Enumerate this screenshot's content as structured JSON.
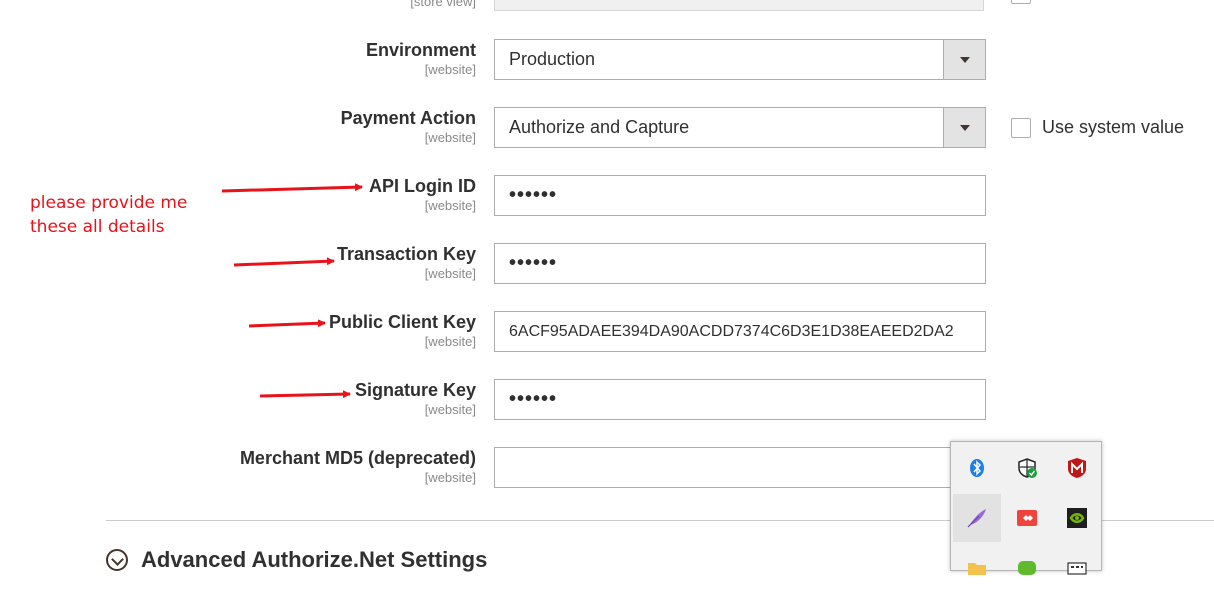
{
  "top_row": {
    "scope": "[store view]"
  },
  "fields": [
    {
      "label": "Environment",
      "scope": "[website]",
      "value": "Production",
      "type": "select"
    },
    {
      "label": "Payment Action",
      "scope": "[website]",
      "value": "Authorize and Capture",
      "type": "select"
    },
    {
      "label": "API Login ID",
      "scope": "[website]",
      "value": "••••••",
      "type": "password"
    },
    {
      "label": "Transaction Key",
      "scope": "[website]",
      "value": "••••••",
      "type": "password"
    },
    {
      "label": "Public Client Key",
      "scope": "[website]",
      "value": "6ACF95ADAEE394DA90ACDD7374C6D3E1D38EAEED2DA2",
      "type": "text"
    },
    {
      "label": "Signature Key",
      "scope": "[website]",
      "value": "••••••",
      "type": "password"
    },
    {
      "label": "Merchant MD5 (deprecated)",
      "scope": "[website]",
      "value": "",
      "type": "text"
    }
  ],
  "use_system_value": {
    "label": "Use system value",
    "checked": false
  },
  "annotation": {
    "line1": "please provide me",
    "line2": "these all details",
    "color": "#e8121b"
  },
  "section": {
    "title": "Advanced Authorize.Net Settings"
  },
  "tray": {
    "icons": [
      "bluetooth-icon",
      "windows-security-icon",
      "mcafee-icon",
      "feather-app-icon",
      "anydesk-icon",
      "nvidia-icon",
      "folder-icon",
      "green-app-icon",
      "keyboard-icon"
    ]
  },
  "colors": {
    "arrow": "#e8121b",
    "text": "#303030",
    "scope": "#8a8a8a",
    "border": "#adadad"
  }
}
